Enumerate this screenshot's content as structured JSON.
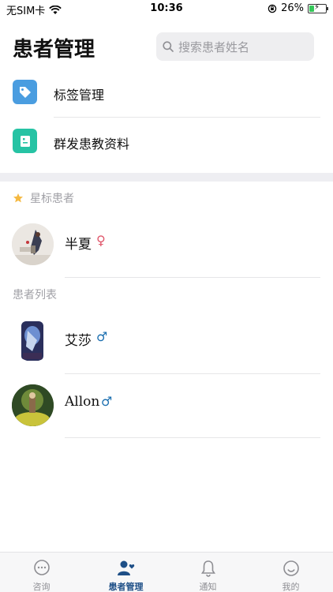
{
  "status_bar": {
    "carrier": "无SIM卡",
    "time": "10:36",
    "battery": "26%"
  },
  "header": {
    "title": "患者管理",
    "search_placeholder": "搜索患者姓名"
  },
  "menu": [
    {
      "label": "标签管理",
      "icon": "tag-icon",
      "color": "#4a9de0"
    },
    {
      "label": "群发患教资料",
      "icon": "document-icon",
      "color": "#26c3a4"
    }
  ],
  "starred": {
    "header": "星标患者",
    "patients": [
      {
        "name": "半夏",
        "gender": "female",
        "gender_symbol": "♀"
      }
    ]
  },
  "list": {
    "header": "患者列表",
    "patients": [
      {
        "name": "艾莎",
        "gender": "male",
        "gender_symbol": "♂"
      },
      {
        "name": "Allon",
        "gender": "male",
        "gender_symbol": "♂"
      }
    ]
  },
  "tabs": [
    {
      "label": "咨询",
      "icon": "chat-bubble-icon",
      "active": false
    },
    {
      "label": "患者管理",
      "icon": "patients-icon",
      "active": true
    },
    {
      "label": "通知",
      "icon": "bell-icon",
      "active": false
    },
    {
      "label": "我的",
      "icon": "smiley-icon",
      "active": false
    }
  ],
  "colors": {
    "accent": "#1e4f87",
    "female": "#e0576b",
    "male": "#1b6fb0",
    "star": "#f5b942"
  }
}
